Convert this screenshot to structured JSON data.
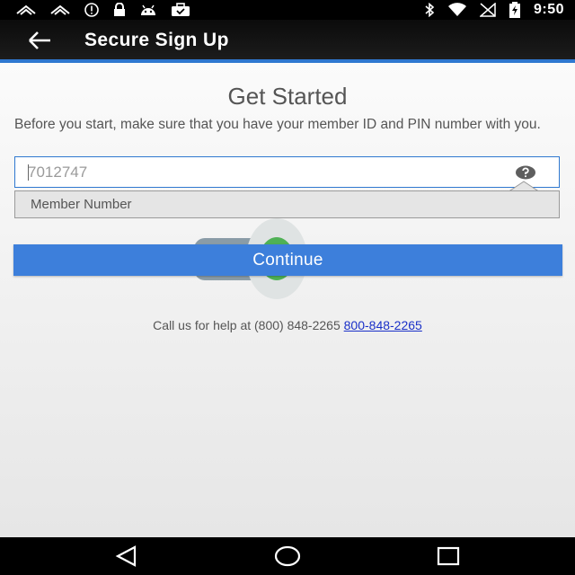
{
  "status_bar": {
    "time": "9:50",
    "left_icons": [
      "signal-icon",
      "signal-icon",
      "alert-icon",
      "lock-icon",
      "android-icon",
      "briefcase-icon"
    ],
    "right_icons": [
      "bluetooth-icon",
      "wifi-icon",
      "no-signal-icon",
      "battery-charging-icon"
    ]
  },
  "app_bar": {
    "title": "Secure Sign Up",
    "back_icon": "back-arrow-icon"
  },
  "main": {
    "heading": "Get Started",
    "intro": "Before you start, make sure that you have your member ID and PIN number with you.",
    "member_input": {
      "value": "7012747",
      "help_icon": "question-icon"
    },
    "tooltip": "Member Number",
    "toggle": {
      "state": "on",
      "color_on": "#4fb155"
    },
    "continue_label": "Continue",
    "help_text": "Call us for help at (800) 848-2265",
    "help_link": "800-848-2265"
  },
  "colors": {
    "accent": "#3d7fdb",
    "link": "#1a30c8"
  },
  "nav_bar": {
    "buttons": [
      "back-triangle-icon",
      "home-circle-icon",
      "recents-square-icon"
    ]
  }
}
